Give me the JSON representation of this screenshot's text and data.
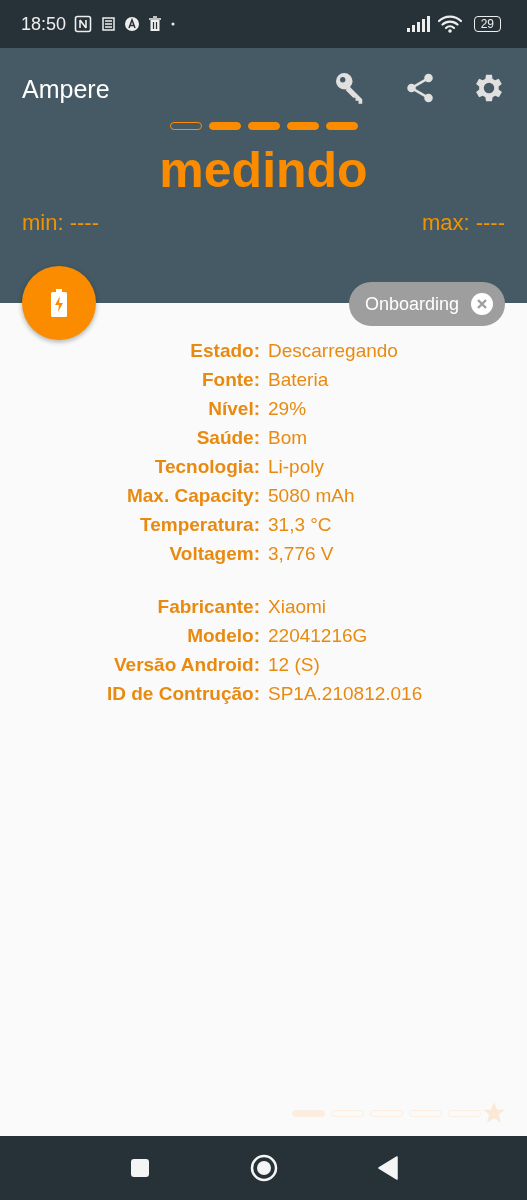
{
  "status_bar": {
    "time": "18:50",
    "battery": "29"
  },
  "app_bar": {
    "title": "Ampere"
  },
  "meter": {
    "segments": [
      {
        "on": false
      },
      {
        "on": true
      },
      {
        "on": true
      },
      {
        "on": true
      },
      {
        "on": true
      }
    ],
    "status": "medindo",
    "min": "min: ----",
    "max": "max: ----"
  },
  "chip": {
    "label": "Onboarding"
  },
  "groups": [
    {
      "rows": [
        {
          "label": "Estado:",
          "value": "Descarregando"
        },
        {
          "label": "Fonte:",
          "value": "Bateria"
        },
        {
          "label": "Nível:",
          "value": "29%"
        },
        {
          "label": "Saúde:",
          "value": "Bom"
        },
        {
          "label": "Tecnologia:",
          "value": "Li-poly"
        },
        {
          "label": "Max. Capacity:",
          "value": "5080 mAh"
        },
        {
          "label": "Temperatura:",
          "value": "31,3 °C"
        },
        {
          "label": "Voltagem:",
          "value": "3,776 V"
        }
      ]
    },
    {
      "rows": [
        {
          "label": "Fabricante:",
          "value": "Xiaomi"
        },
        {
          "label": "Modelo:",
          "value": "22041216G"
        },
        {
          "label": "Versão Android:",
          "value": "12 (S)"
        },
        {
          "label": "ID de Contrução:",
          "value": "SP1A.210812.016"
        }
      ]
    }
  ],
  "pages": [
    {
      "selected": true
    },
    {
      "selected": false
    },
    {
      "selected": false
    },
    {
      "selected": false
    },
    {
      "selected": false
    }
  ]
}
